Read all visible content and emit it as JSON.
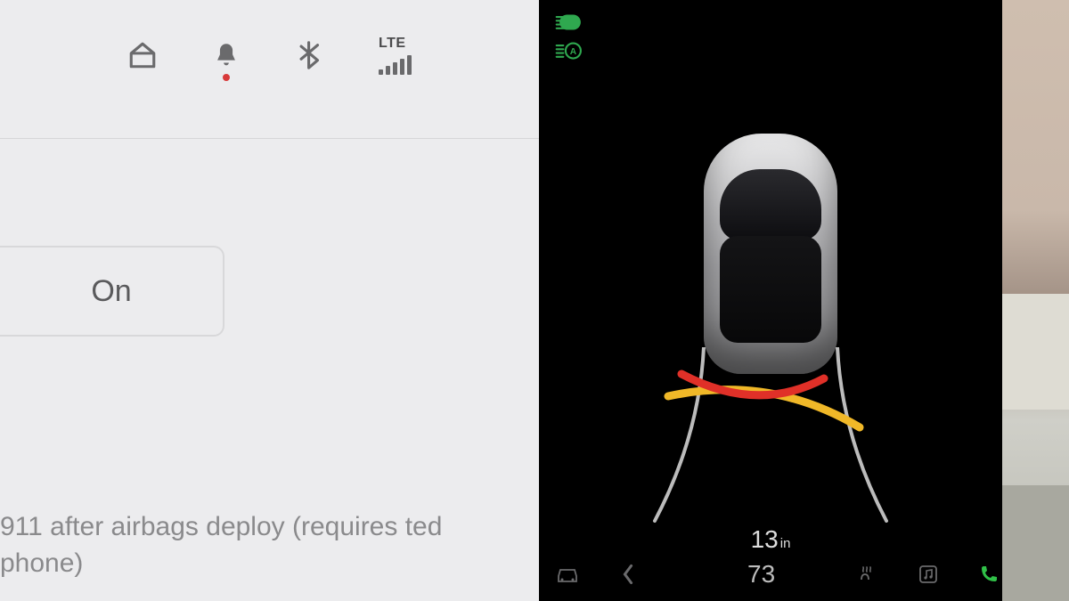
{
  "status": {
    "network_label": "LTE",
    "has_notification_dot": true
  },
  "settings": {
    "toggle_label": "On",
    "description": "911 after airbags deploy (requires ted phone)"
  },
  "vehicle_view": {
    "distance_value": "13",
    "distance_unit": "in",
    "bottom_temp": "73",
    "proximity_arcs": {
      "near_color": "#e03028",
      "mid_color": "#f0b828"
    }
  }
}
